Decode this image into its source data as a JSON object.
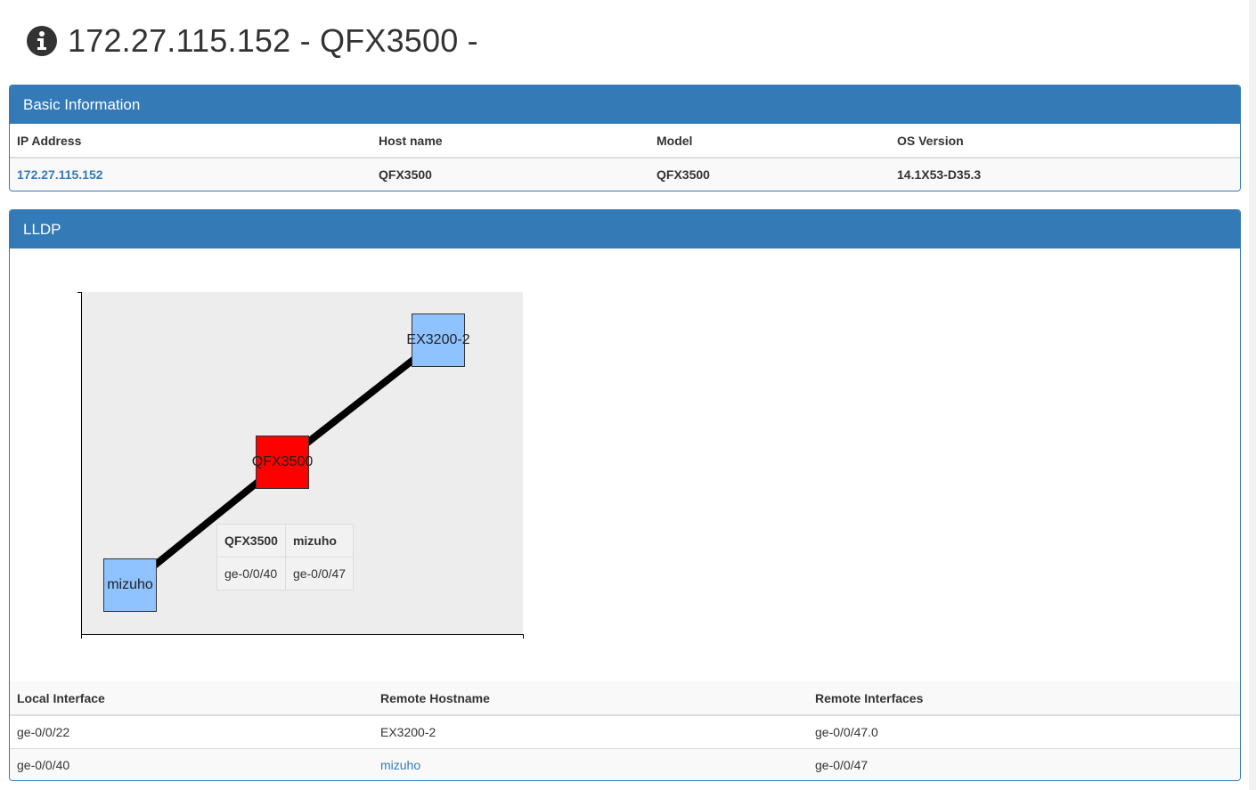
{
  "page": {
    "title": "172.27.115.152 - QFX3500 -",
    "icon": "info-circle-icon"
  },
  "basic_info": {
    "heading": "Basic Information",
    "columns": [
      "IP Address",
      "Host name",
      "Model",
      "OS Version"
    ],
    "row": {
      "ip": "172.27.115.152",
      "hostname": "QFX3500",
      "model": "QFX3500",
      "os_version": "14.1X53-D35.3"
    }
  },
  "lldp": {
    "heading": "LLDP",
    "graph": {
      "nodes": [
        {
          "id": "mizuho",
          "label": "mizuho",
          "color": "#8fc3ff"
        },
        {
          "id": "qfx3500",
          "label": "QFX3500",
          "color": "#ff0000"
        },
        {
          "id": "ex3200",
          "label": "EX3200-2",
          "color": "#8fc3ff"
        }
      ],
      "edges": [
        {
          "from": "mizuho",
          "to": "qfx3500"
        },
        {
          "from": "qfx3500",
          "to": "ex3200"
        }
      ],
      "tooltip": {
        "headers": [
          "QFX3500",
          "mizuho"
        ],
        "values": [
          "ge-0/0/40",
          "ge-0/0/47"
        ]
      },
      "toolbar_icons": [
        "home-icon",
        "pan-icon",
        "zoom-icon"
      ]
    },
    "columns": [
      "Local Interface",
      "Remote Hostname",
      "Remote Interfaces"
    ],
    "rows": [
      {
        "local": "ge-0/0/22",
        "remote_host": "EX3200-2",
        "remote_if": "ge-0/0/47.0"
      },
      {
        "local": "ge-0/0/40",
        "remote_host": "mizuho",
        "remote_if": "ge-0/0/47"
      }
    ]
  },
  "colors": {
    "primary": "#337ab7",
    "node_blue": "#8fc3ff",
    "node_red": "#ff0000"
  }
}
